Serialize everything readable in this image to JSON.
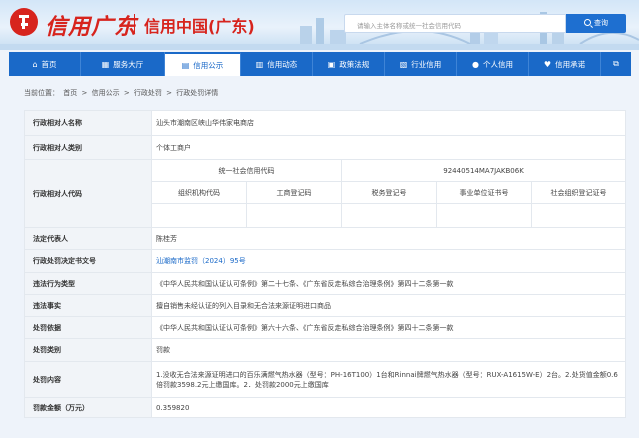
{
  "header": {
    "brand_script": "信用广东",
    "brand_name": "信用中国(广东)",
    "search_placeholder": "请输入主体名称或统一社会信用代码",
    "search_button": "查询"
  },
  "nav": [
    {
      "label": "首页",
      "icon": "home-icon",
      "glyph": "⌂"
    },
    {
      "label": "服务大厅",
      "icon": "grid-icon",
      "glyph": "▦"
    },
    {
      "label": "信用公示",
      "icon": "folder-icon",
      "glyph": "▤",
      "active": true
    },
    {
      "label": "信用动态",
      "icon": "document-icon",
      "glyph": "▥"
    },
    {
      "label": "政策法规",
      "icon": "book-icon",
      "glyph": "▣"
    },
    {
      "label": "行业信用",
      "icon": "building-icon",
      "glyph": "▧"
    },
    {
      "label": "个人信用",
      "icon": "person-icon",
      "glyph": "●"
    },
    {
      "label": "信用承诺",
      "icon": "heart-icon",
      "glyph": "♥"
    },
    {
      "label": "",
      "icon": "external-link-icon",
      "glyph": "⧉"
    }
  ],
  "breadcrumb": {
    "prefix": "当前位置：",
    "items": [
      "首页",
      "信用公示",
      "行政处罚",
      "行政处罚详情"
    ],
    "sep": ">"
  },
  "detail": {
    "counterpart_name_label": "行政相对人名称",
    "counterpart_name": "汕头市潮南区峡山华伟家电商店",
    "counterpart_type_label": "行政相对人类别",
    "counterpart_type": "个体工商户",
    "counterpart_code_label": "行政相对人代码",
    "uscc_label": "统一社会信用代码",
    "uscc": "92440514MA7JAKB06K",
    "code_headers": [
      "组织机构代码",
      "工商登记码",
      "税务登记号",
      "事业单位证书号",
      "社会组织登记证号"
    ],
    "code_values": [
      "",
      "",
      "",
      "",
      ""
    ],
    "legal_rep_label": "法定代表人",
    "legal_rep": "陈桂芳",
    "decision_no_label": "行政处罚决定书文号",
    "decision_no": "汕潮南市监罚（2024）95号",
    "violation_type_label": "违法行为类型",
    "violation_type": "《中华人民共和国认证认可条例》第二十七条、《广东省反走私综合治理条例》第四十二条第一款",
    "violation_fact_label": "违法事实",
    "violation_fact": "擅自销售未经认证的列入目录和无合法来源证明进口商品",
    "basis_label": "处罚依据",
    "basis": "《中华人民共和国认证认可条例》第六十六条、《广东省反走私综合治理条例》第四十二条第一款",
    "category_label": "处罚类别",
    "category": "罚款",
    "content_label": "处罚内容",
    "content": "1.没收无合法来源证明进口的百乐满燃气热水器（型号：PH-16T100）1台和Rinnai牌燃气热水器（型号：RUX-A1615W-E）2台。2.处货值金额0.6倍罚款3598.2元上缴国库。2．处罚款2000元上缴国库",
    "fine_label": "罚款金额（万元）",
    "fine": "0.359820"
  }
}
